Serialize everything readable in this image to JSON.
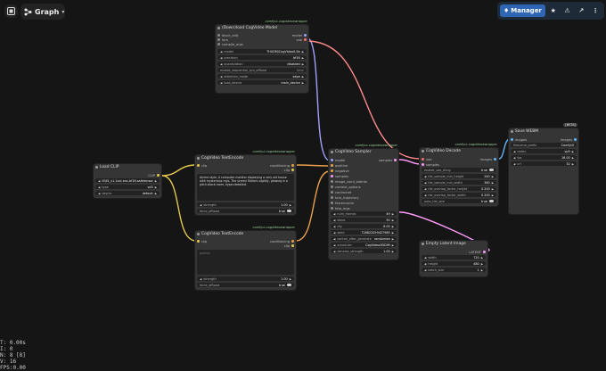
{
  "toolbar": {
    "graph_label": "Graph"
  },
  "topbar": {
    "manager_label": "Manager"
  },
  "colors": {
    "clip": "#e4c84c",
    "conditioning": "#e9a24a",
    "model": "#b39ddb",
    "latent": "#ff9cf9",
    "image": "#64b5f6",
    "vae": "#ff6e6e",
    "cogmodel": "#a0a0ff"
  },
  "nodes": {
    "download": {
      "tag": "comfyui-cogvideoxwrapper",
      "title": "(Down)load CogVideo Model",
      "inputs": [
        "block_edit",
        "lora",
        "compile_args"
      ],
      "outputs": [
        "model",
        "vae"
      ],
      "widgets": [
        {
          "label": "model",
          "value": "THUDM/CogVideoX-5b"
        },
        {
          "label": "precision",
          "value": "bf16"
        },
        {
          "label": "quantization",
          "value": "disabled"
        },
        {
          "label": "enable_sequential_cpu_offload",
          "value": "false"
        },
        {
          "label": "attention_mode",
          "value": "sdpa"
        },
        {
          "label": "load_device",
          "value": "main_device"
        }
      ]
    },
    "clip": {
      "title": "Load CLIP",
      "output": "CLIP",
      "widgets": [
        {
          "label": "clip_name",
          "value": "t5\\t5_v1.1xxl-enc-bf16.safetensors"
        },
        {
          "label": "type",
          "value": "sd3"
        },
        {
          "label": "device",
          "value": "default"
        }
      ]
    },
    "enc1": {
      "tag": "comfyui-cogvideoxwrapper",
      "title": "CogVideo TextEncode",
      "input": "clip",
      "outputs": [
        "conditioning",
        "clip"
      ],
      "text": "Anime style, A computer monitor displaying a very old house with mysterious rays. The screen flickers slightly, glowing in a pitch-black room, hyper-detailed.",
      "widgets": [
        {
          "label": "strength",
          "value": "1.00"
        },
        {
          "label": "force_offload",
          "value": "true"
        }
      ]
    },
    "enc2": {
      "tag": "comfyui-cogvideoxwrapper",
      "title": "CogVideo TextEncode",
      "input": "clip",
      "outputs": [
        "conditioning",
        "clip"
      ],
      "text": "prompt",
      "widgets": [
        {
          "label": "strength",
          "value": "1.00"
        },
        {
          "label": "force_offload",
          "value": "true"
        }
      ]
    },
    "sampler": {
      "tag": "comfyui-cogvideoxwrapper",
      "title": "CogVideo Sampler",
      "inputs": [
        "model",
        "positive",
        "negative",
        "samples",
        "image_cond_latents",
        "context_options",
        "controlnet",
        "tora_trajectory",
        "fastercache",
        "feta_args"
      ],
      "output": "samples",
      "widgets": [
        {
          "label": "num_frames",
          "value": "49"
        },
        {
          "label": "steps",
          "value": "50"
        },
        {
          "label": "cfg",
          "value": "6.00"
        },
        {
          "label": "seed",
          "value": "728822059427985"
        },
        {
          "label": "control_after_generate",
          "value": "randomize"
        },
        {
          "label": "scheduler",
          "value": "CogVideoXDDIM"
        },
        {
          "label": "denoise_strength",
          "value": "1.00"
        }
      ]
    },
    "decode": {
      "tag": "comfyui-cogvideoxwrapper",
      "title": "CogVideo Decode",
      "inputs": [
        "vae",
        "samples"
      ],
      "output": "images",
      "widgets": [
        {
          "label": "enable_vae_tiling",
          "value": "true"
        },
        {
          "label": "tile_sample_min_height",
          "value": "240"
        },
        {
          "label": "tile_sample_min_width",
          "value": "360"
        },
        {
          "label": "tile_overlap_factor_height",
          "value": "0.200"
        },
        {
          "label": "tile_overlap_factor_width",
          "value": "0.200"
        },
        {
          "label": "auto_tile_size",
          "value": "true"
        }
      ]
    },
    "save": {
      "badge": "[BETA]",
      "title": "Save WEBM",
      "input": "images",
      "output": "images",
      "widgets": [
        {
          "label": "filename_prefix",
          "value": "ComfyUI"
        },
        {
          "label": "codec",
          "value": "vp9"
        },
        {
          "label": "fps",
          "value": "16.00"
        },
        {
          "label": "crf",
          "value": "32"
        }
      ]
    },
    "empty": {
      "title": "Empty Latent Image",
      "output": "LATENT",
      "widgets": [
        {
          "label": "width",
          "value": "720"
        },
        {
          "label": "height",
          "value": "480"
        },
        {
          "label": "batch_size",
          "value": "1"
        }
      ]
    }
  },
  "stats": [
    "T: 0.00s",
    "I: 0",
    "N: 8 [8]",
    "V: 16",
    "FPS:0.00"
  ]
}
